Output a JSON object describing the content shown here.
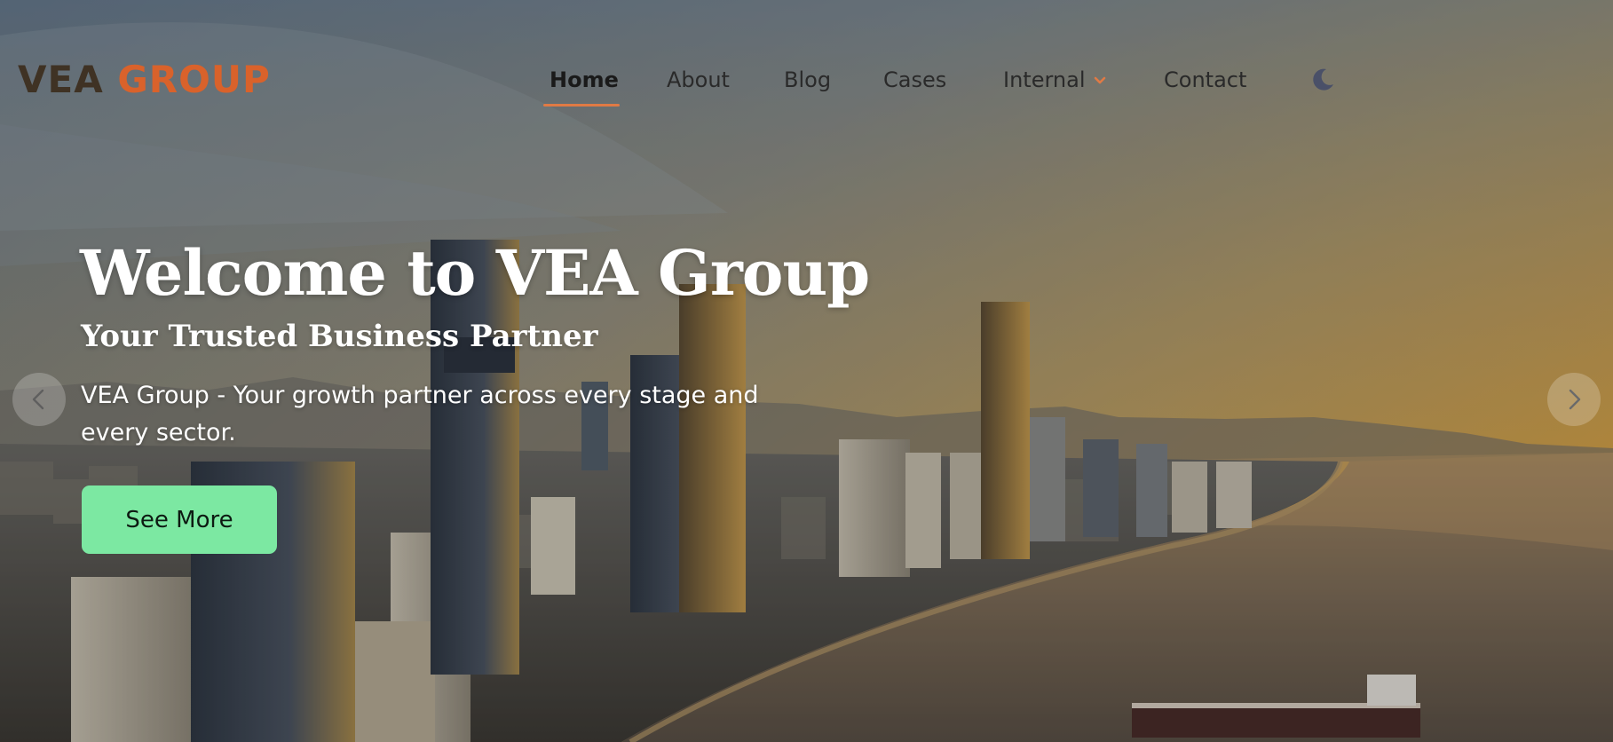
{
  "brand": {
    "logo_text": "VEA GROUP",
    "colors": {
      "dark": "#4a3a2a",
      "orange": "#d9622b",
      "accent": "#e07a45"
    }
  },
  "nav": {
    "items": [
      {
        "label": "Home",
        "active": true
      },
      {
        "label": "About",
        "active": false
      },
      {
        "label": "Blog",
        "active": false
      },
      {
        "label": "Cases",
        "active": false
      },
      {
        "label": "Internal",
        "active": false,
        "has_dropdown": true
      },
      {
        "label": "Contact",
        "active": false
      }
    ],
    "theme_toggle_icon": "moon-icon"
  },
  "hero": {
    "title": "Welcome to VEA Group",
    "subtitle": "Your Trusted Business Partner",
    "description": "VEA Group - Your growth partner across every stage and every sector.",
    "cta_label": "See More",
    "cta_color": "#7ce8a2",
    "prev_icon": "chevron-left-icon",
    "next_icon": "chevron-right-icon"
  }
}
